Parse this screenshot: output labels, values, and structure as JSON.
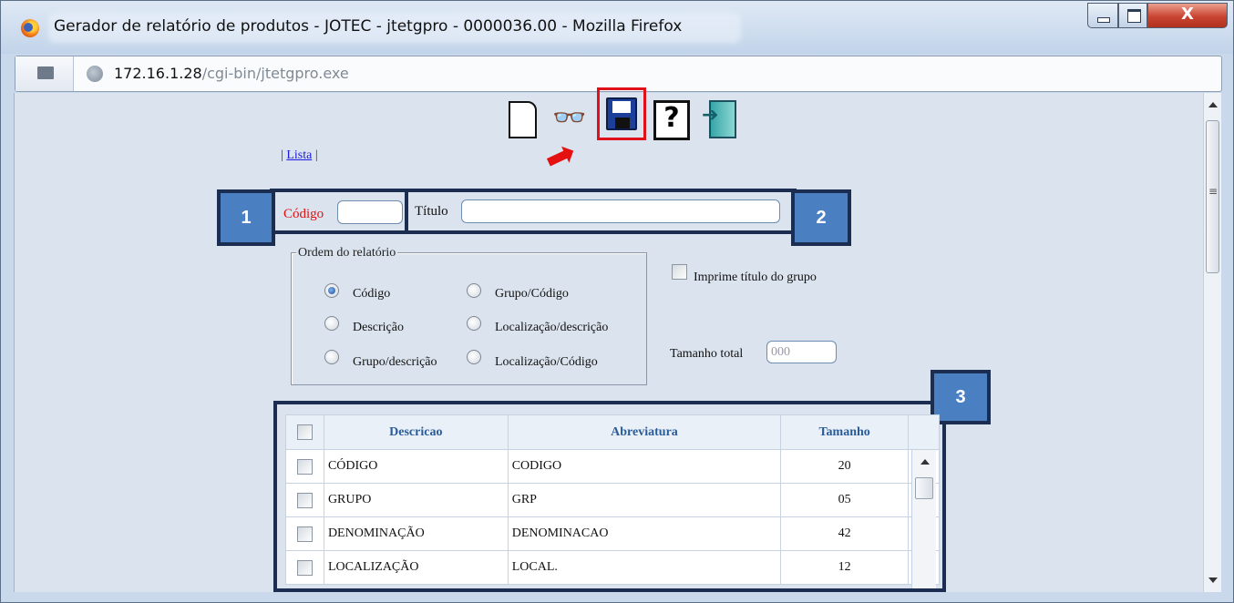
{
  "window": {
    "title": "Gerador de relatório de produtos - JOTEC - jtetgpro - 0000036.00 - Mozilla Firefox",
    "close_label": "X"
  },
  "address": {
    "host": "172.16.1.28",
    "path": "/cgi-bin/jtetgpro.exe"
  },
  "toolbar": {
    "icons": [
      "new-document-icon",
      "binoculars-icon",
      "floppy-disk-icon",
      "help-icon",
      "exit-door-icon"
    ],
    "find_glyph": "🔭",
    "save_highlight_color": "#e0101a"
  },
  "nav": {
    "prefix": "|",
    "lista_label": "Lista",
    "suffix": "|"
  },
  "form": {
    "codigo_label": "Código",
    "codigo_value": "",
    "titulo_label": "Título",
    "titulo_value": "",
    "imprime_label": "Imprime título do grupo",
    "imprime_checked": false,
    "tamanho_label": "Tamanho total",
    "tamanho_placeholder": "000"
  },
  "ordem": {
    "legend": "Ordem do relatório",
    "options": [
      {
        "label": "Código",
        "selected": true
      },
      {
        "label": "Descrição",
        "selected": false
      },
      {
        "label": "Grupo/descrição",
        "selected": false
      },
      {
        "label": "Grupo/Código",
        "selected": false
      },
      {
        "label": "Localização/descrição",
        "selected": false
      },
      {
        "label": "Localização/Código",
        "selected": false
      }
    ]
  },
  "badges": {
    "b1": "1",
    "b2": "2",
    "b3": "3",
    "color": "#4a7fc2",
    "border_color": "#1c2d52"
  },
  "table": {
    "headers": [
      "Descricao",
      "Abreviatura",
      "Tamanho"
    ],
    "rows": [
      {
        "descricao": "CÓDIGO",
        "abreviatura": "CODIGO",
        "tamanho": "20"
      },
      {
        "descricao": "GRUPO",
        "abreviatura": "GRP",
        "tamanho": "05"
      },
      {
        "descricao": "DENOMINAÇÃO",
        "abreviatura": "DENOMINACAO",
        "tamanho": "42"
      },
      {
        "descricao": "LOCALIZAÇÃO",
        "abreviatura": "LOCAL.",
        "tamanho": "12"
      }
    ]
  }
}
